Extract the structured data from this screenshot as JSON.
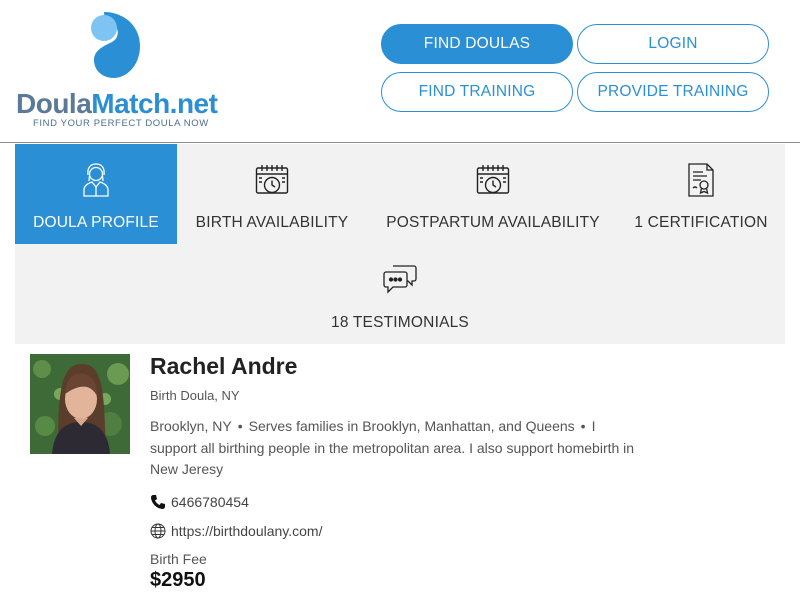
{
  "header": {
    "logo_word_a": "Doula",
    "logo_word_b": "Match.net",
    "logo_tagline": "FIND YOUR PERFECT DOULA NOW",
    "nav": {
      "find_doulas": "FIND DOULAS",
      "login": "LOGIN",
      "find_training": "FIND TRAINING",
      "provide_training": "PROVIDE TRAINING"
    }
  },
  "tabs": [
    {
      "label": "DOULA PROFILE",
      "icon": "doula-profile-icon",
      "active": true
    },
    {
      "label": "BIRTH AVAILABILITY",
      "icon": "calendar-clock-icon",
      "active": false
    },
    {
      "label": "POSTPARTUM AVAILABILITY",
      "icon": "calendar-clock-icon",
      "active": false
    },
    {
      "label": "1 CERTIFICATION",
      "icon": "certificate-icon",
      "active": false
    },
    {
      "label": "18 TESTIMONIALS",
      "icon": "chat-bubbles-icon",
      "active": false
    }
  ],
  "profile": {
    "name": "Rachel Andre",
    "subtitle": "Birth Doula, NY",
    "bio_location": "Brooklyn, NY",
    "bio_service_area": "Serves families in Brooklyn, Manhattan, and Queens",
    "bio_text": "I support all birthing people in the metropolitan area. I also support homebirth in New Jeresy",
    "phone": "6466780454",
    "website": "https://birthdoulany.com/",
    "fee_label": "Birth Fee",
    "fee_value": "$2950"
  },
  "colors": {
    "accent": "#2b8fd6",
    "tab_bg": "#f2f2f2",
    "logo_gray": "#5a7a98"
  }
}
